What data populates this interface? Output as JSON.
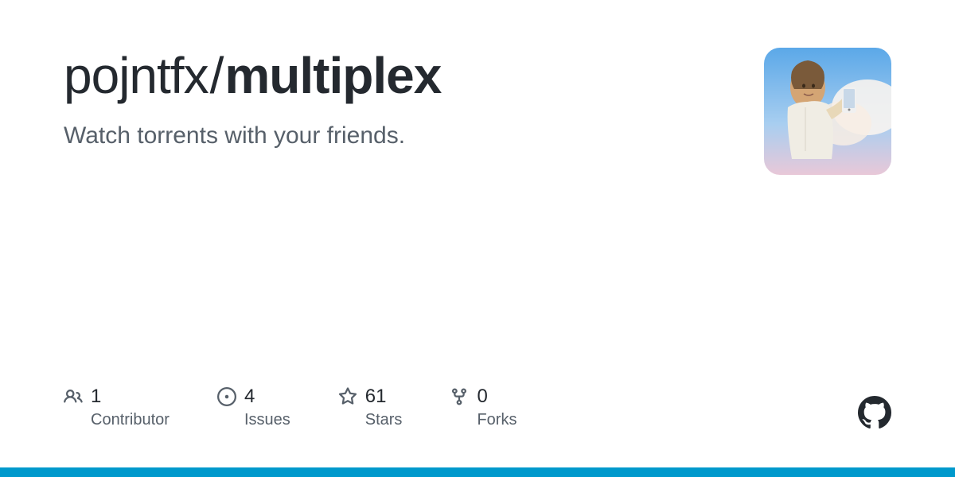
{
  "repo": {
    "owner": "pojntfx",
    "separator": "/",
    "name": "multiplex",
    "description": "Watch torrents with your friends."
  },
  "stats": {
    "contributors": {
      "count": "1",
      "label": "Contributor"
    },
    "issues": {
      "count": "4",
      "label": "Issues"
    },
    "stars": {
      "count": "61",
      "label": "Stars"
    },
    "forks": {
      "count": "0",
      "label": "Forks"
    }
  }
}
